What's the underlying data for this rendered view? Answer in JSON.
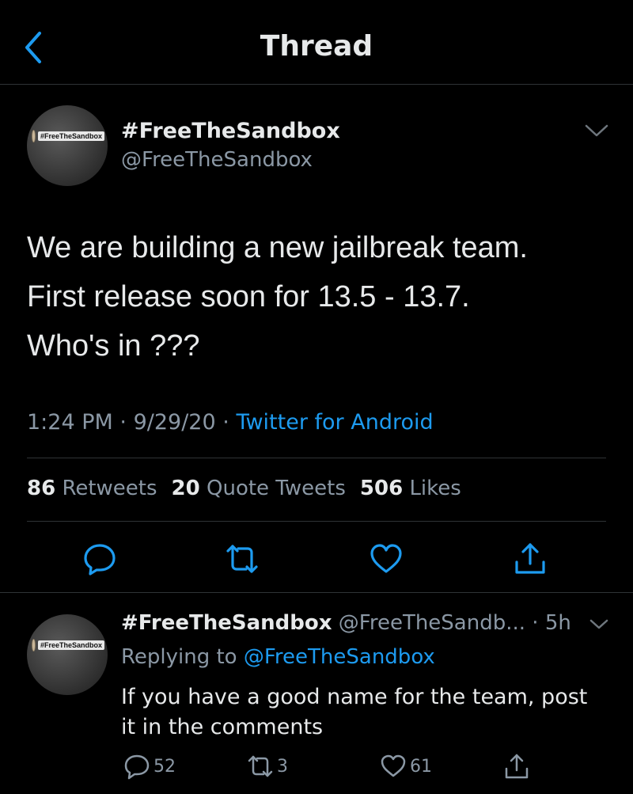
{
  "header": {
    "title": "Thread"
  },
  "tweet": {
    "name": "#FreeTheSandbox",
    "handle": "@FreeTheSandbox",
    "avatar_text": "#FreeTheSandbox",
    "lines": [
      "We are building a new jailbreak team.",
      "First release soon for 13.5 - 13.7.",
      "Who's in ???"
    ],
    "time": "1:24 PM",
    "date": "9/29/20",
    "separator": "·",
    "source": "Twitter for Android",
    "stats": {
      "retweets_count": "86",
      "retweets_label": "Retweets",
      "quotes_count": "20",
      "quotes_label": "Quote Tweets",
      "likes_count": "506",
      "likes_label": "Likes"
    }
  },
  "reply": {
    "name": "#FreeTheSandbox",
    "handle": "@FreeTheSandb...",
    "separator": "·",
    "age": "5h",
    "avatar_text": "#FreeTheSandbox",
    "replying_label": "Replying to",
    "replying_handle": "@FreeTheSandbox",
    "lines": [
      "If you have a good name for the team, post",
      "it in the comments"
    ],
    "reply_count": "52",
    "retweet_count": "3",
    "like_count": "61"
  },
  "colors": {
    "background": "#000000",
    "accent": "#1d9bf0",
    "secondary_text": "#8b98a5",
    "primary_text": "#e7e9ea",
    "divider": "#2f3336"
  },
  "icons": {
    "back": "chevron-left-icon",
    "more": "chevron-down-icon",
    "reply": "comment-icon",
    "retweet": "retweet-icon",
    "like": "heart-icon",
    "share": "share-icon"
  }
}
